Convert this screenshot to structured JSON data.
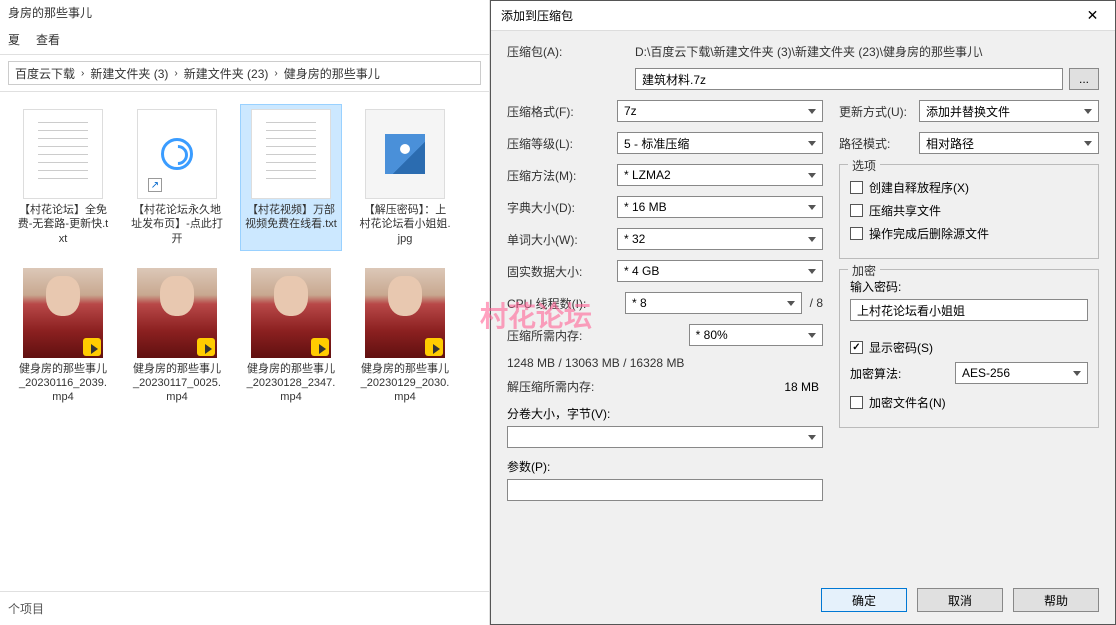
{
  "explorer": {
    "title": "身房的那些事儿",
    "menu": {
      "item1": "夏",
      "item2": "查看"
    },
    "breadcrumb": {
      "items": [
        "百度云下载",
        "新建文件夹 (3)",
        "新建文件夹 (23)",
        "健身房的那些事儿"
      ]
    },
    "files": [
      {
        "name": "【村花论坛】全免费-无套路-更新快.txt",
        "type": "txt"
      },
      {
        "name": "【村花论坛永久地址发布页】-点此打开",
        "type": "link"
      },
      {
        "name": "【村花视频】万部视频免费在线看.txt",
        "type": "txt",
        "selected": true
      },
      {
        "name": "【解压密码】：上村花论坛看小姐姐.jpg",
        "type": "img"
      },
      {
        "name": "健身房的那些事儿_20230116_2039.mp4",
        "type": "video"
      },
      {
        "name": "健身房的那些事儿_20230117_0025.mp4",
        "type": "video"
      },
      {
        "name": "健身房的那些事儿_20230128_2347.mp4",
        "type": "video"
      },
      {
        "name": "健身房的那些事儿_20230129_2030.mp4",
        "type": "video"
      }
    ],
    "status": "个项目"
  },
  "dialog": {
    "title": "添加到压缩包",
    "close": "✕",
    "archive_label": "压缩包(A)",
    "archive_path": "D:\\百度云下载\\新建文件夹 (3)\\新建文件夹 (23)\\健身房的那些事儿\\",
    "archive_name": "建筑材料.7z",
    "browse": "...",
    "format_label": "压缩格式(F):",
    "format_value": "7z",
    "level_label": "压缩等级(L):",
    "level_value": "5 - 标准压缩",
    "method_label": "压缩方法(M):",
    "method_value": "* LZMA2",
    "dict_label": "字典大小(D):",
    "dict_value": "* 16 MB",
    "word_label": "单词大小(W):",
    "word_value": "* 32",
    "solid_label": "固实数据大小:",
    "solid_value": "* 4 GB",
    "cpu_label": "CPU 线程数(I):",
    "cpu_value": "* 8",
    "cpu_total": "/ 8",
    "mem_comp_label": "压缩所需内存:",
    "mem_comp_value": "1248 MB / 13063 MB / 16328 MB",
    "mem_comp_pct": "* 80%",
    "mem_decomp_label": "解压缩所需内存:",
    "mem_decomp_value": "18 MB",
    "split_label": "分卷大小，字节(V):",
    "params_label": "参数(P):",
    "update_label": "更新方式(U):",
    "update_value": "添加并替换文件",
    "pathmode_label": "路径模式:",
    "pathmode_value": "相对路径",
    "options_legend": "选项",
    "opt_sfx": "创建自释放程序(X)",
    "opt_share": "压缩共享文件",
    "opt_delete": "操作完成后删除源文件",
    "encrypt_legend": "加密",
    "pw_label": "输入密码:",
    "pw_value": "上村花论坛看小姐姐",
    "show_pw": "显示密码(S)",
    "algo_label": "加密算法:",
    "algo_value": "AES-256",
    "encrypt_names": "加密文件名(N)",
    "btn_ok": "确定",
    "btn_cancel": "取消",
    "btn_help": "帮助"
  },
  "watermark": "村花论坛"
}
